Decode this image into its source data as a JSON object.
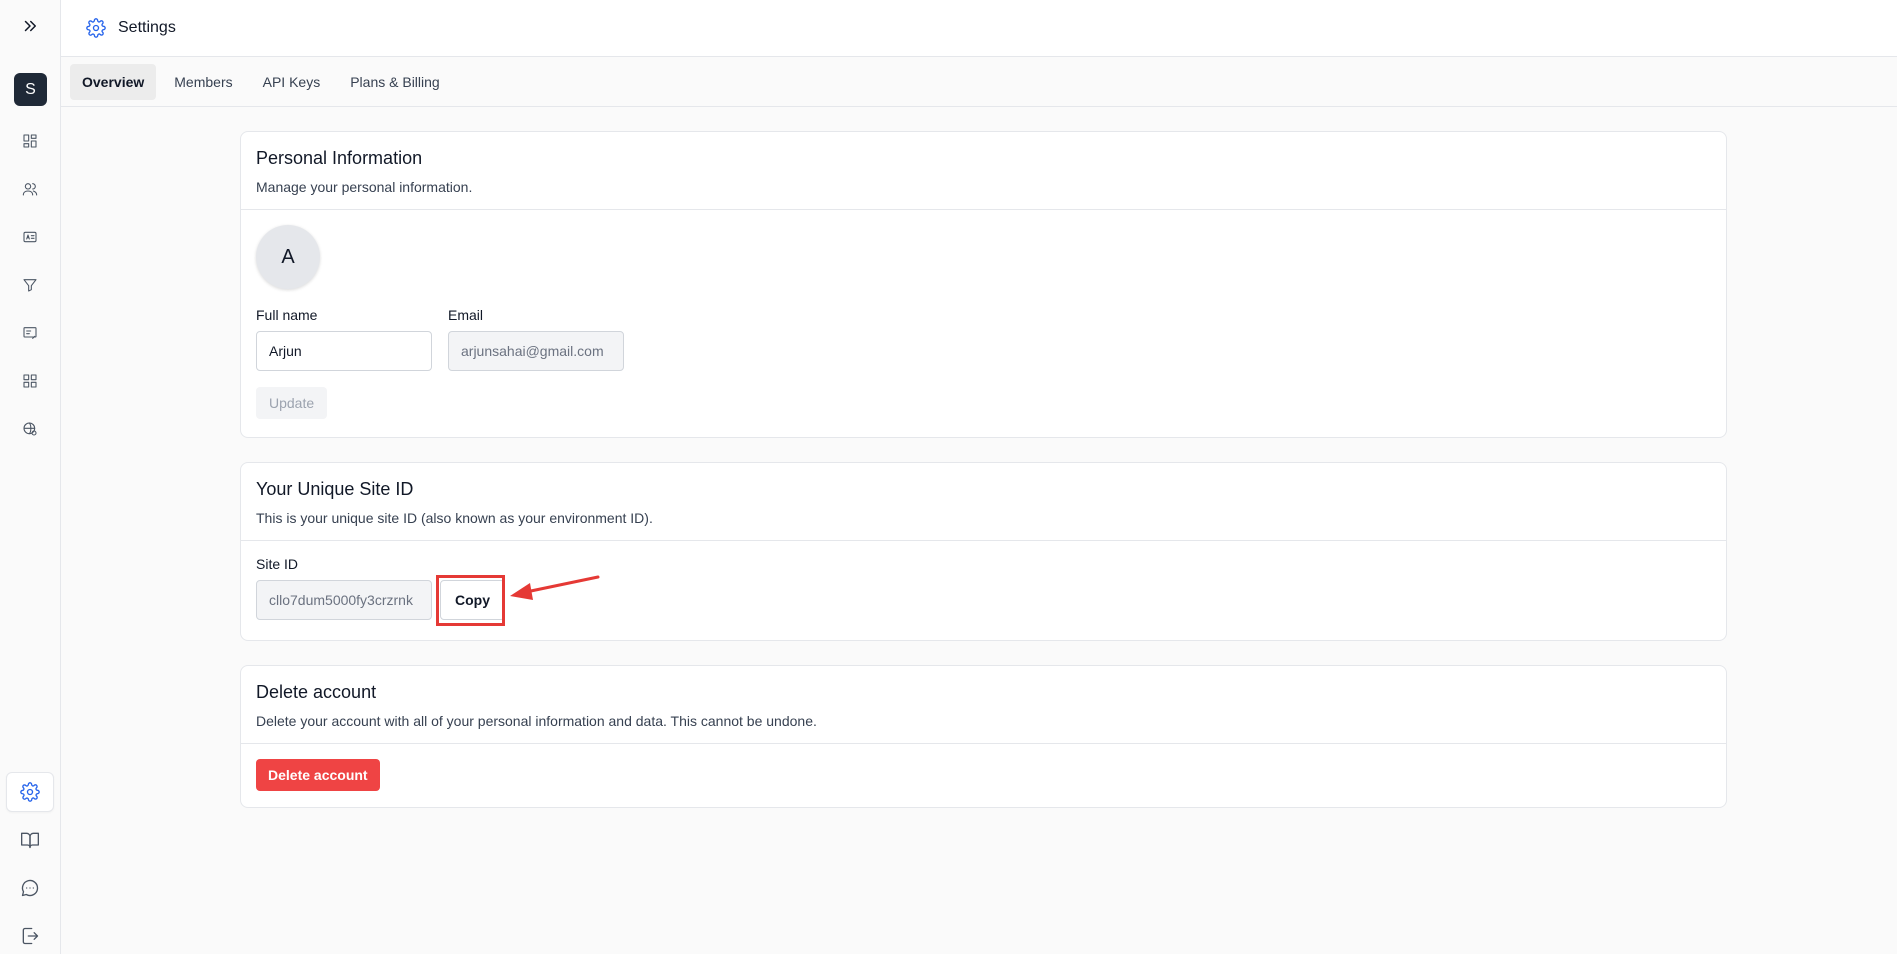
{
  "header": {
    "title": "Settings"
  },
  "sidebar": {
    "workspace_initial": "S"
  },
  "tabs": [
    {
      "label": "Overview",
      "active": true
    },
    {
      "label": "Members",
      "active": false
    },
    {
      "label": "API Keys",
      "active": false
    },
    {
      "label": "Plans & Billing",
      "active": false
    }
  ],
  "personal": {
    "title": "Personal Information",
    "description": "Manage your personal information.",
    "avatar_initial": "A",
    "full_name_label": "Full name",
    "full_name_value": "Arjun",
    "email_label": "Email",
    "email_value": "arjunsahai@gmail.com",
    "update_label": "Update"
  },
  "site": {
    "title": "Your Unique Site ID",
    "description": "This is your unique site ID (also known as your environment ID).",
    "site_id_label": "Site ID",
    "site_id_value": "cllo7dum5000fy3crzrnk",
    "copy_label": "Copy"
  },
  "delete": {
    "title": "Delete account",
    "description": "Delete your account with all of your personal information and data. This cannot be undone.",
    "button_label": "Delete account"
  },
  "colors": {
    "accent": "#2563eb",
    "danger": "#ef4444",
    "annotation": "#e53935"
  }
}
